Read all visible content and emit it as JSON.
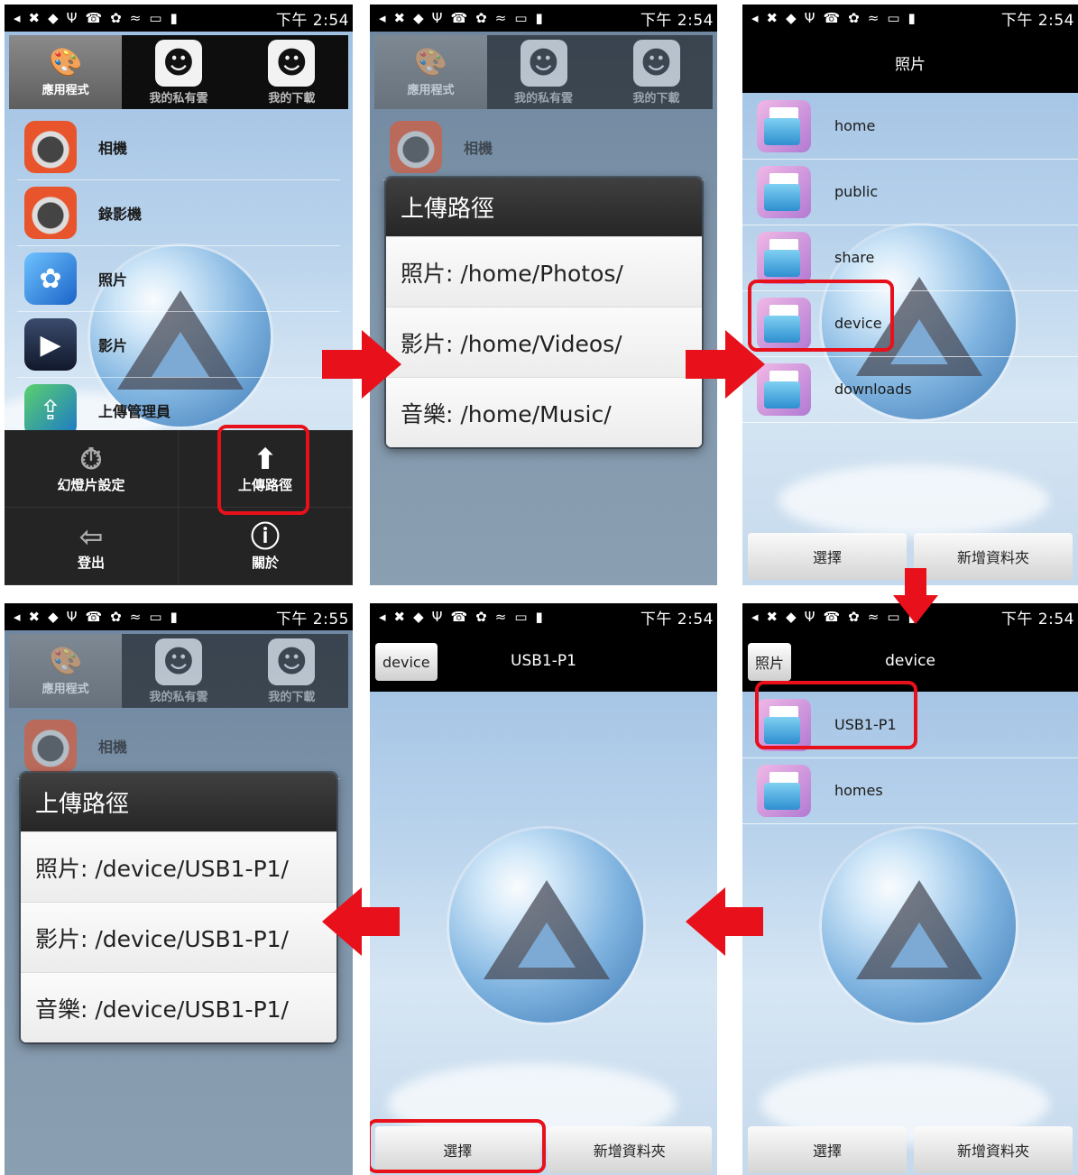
{
  "status": {
    "icons": [
      "◂",
      "✖",
      "◆",
      "Ψ",
      "☎",
      "✿",
      "≈",
      "▭",
      "▮"
    ],
    "times": [
      "下午 2:54",
      "下午 2:54",
      "下午 2:54",
      "下午 2:55",
      "下午 2:54",
      "下午 2:54"
    ]
  },
  "tabs": [
    {
      "label": "應用程式",
      "icon": "palette-icon"
    },
    {
      "label": "我的私有雲",
      "icon": "smiley-icon"
    },
    {
      "label": "我的下載",
      "icon": "smiley-icon"
    }
  ],
  "apps": [
    {
      "label": "相機",
      "icon": "camera-icon"
    },
    {
      "label": "錄影機",
      "icon": "camcorder-icon"
    },
    {
      "label": "照片",
      "icon": "photo-icon"
    },
    {
      "label": "影片",
      "icon": "video-icon"
    },
    {
      "label": "上傳管理員",
      "icon": "upload-manager-icon"
    }
  ],
  "menu": {
    "slideshow": "幻燈片設定",
    "upload_path": "上傳路徑",
    "logout": "登出",
    "about": "關於"
  },
  "dialog1": {
    "title": "上傳路徑",
    "items": [
      "照片: /home/Photos/",
      "影片: /home/Videos/",
      "音樂: /home/Music/"
    ]
  },
  "browser1": {
    "title": "照片",
    "folders": [
      "home",
      "public",
      "share",
      "device",
      "downloads"
    ],
    "select": "選擇",
    "new_folder": "新增資料夾"
  },
  "browser2": {
    "back": "照片",
    "title": "device",
    "folders": [
      "USB1-P1",
      "homes"
    ],
    "select": "選擇",
    "new_folder": "新增資料夾"
  },
  "browser3": {
    "back": "device",
    "title": "USB1-P1",
    "select": "選擇",
    "new_folder": "新增資料夾"
  },
  "dialog2": {
    "title": "上傳路徑",
    "items": [
      "照片: /device/USB1-P1/",
      "影片: /device/USB1-P1/",
      "音樂: /device/USB1-P1/"
    ]
  },
  "colors": {
    "highlight": "#e8101a",
    "arrow": "#e8101a"
  }
}
